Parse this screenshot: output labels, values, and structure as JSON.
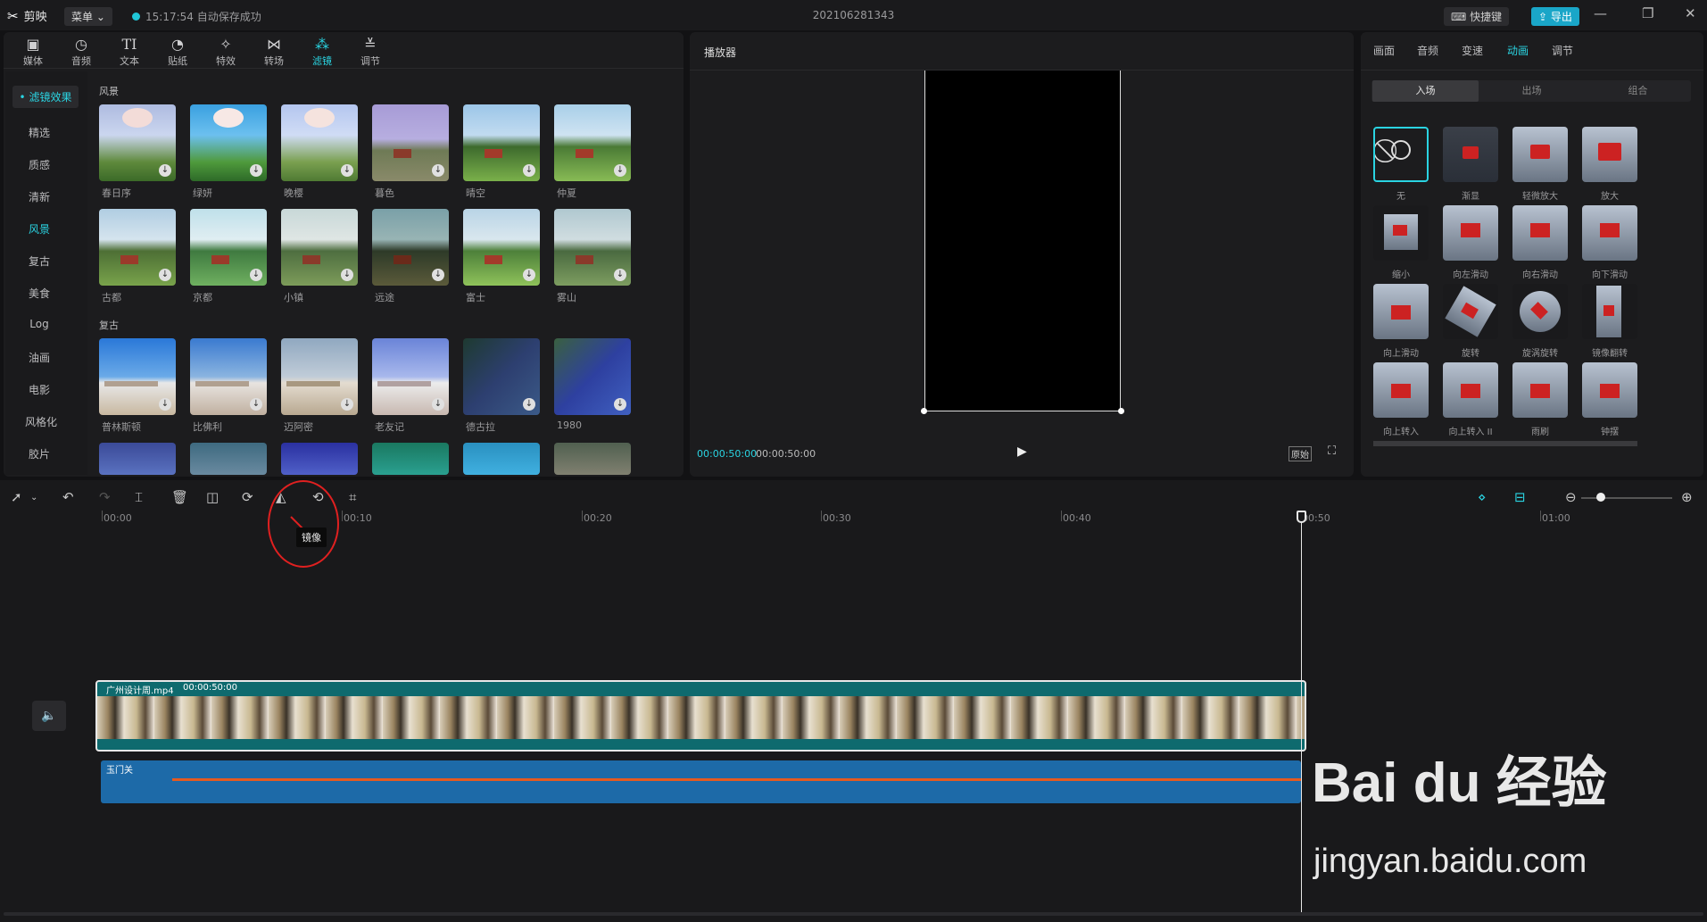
{
  "titlebar": {
    "app_name": "剪映",
    "menu_label": "菜单",
    "save_status": "15:17:54 自动保存成功",
    "project_name": "202106281343",
    "shortcut_label": "快捷键",
    "export_label": "导出"
  },
  "toolbar": {
    "items": [
      {
        "label": "媒体",
        "icon": "media-icon"
      },
      {
        "label": "音频",
        "icon": "audio-icon"
      },
      {
        "label": "文本",
        "icon": "text-icon"
      },
      {
        "label": "贴纸",
        "icon": "sticker-icon"
      },
      {
        "label": "特效",
        "icon": "effects-icon"
      },
      {
        "label": "转场",
        "icon": "transition-icon"
      },
      {
        "label": "滤镜",
        "icon": "filter-icon"
      },
      {
        "label": "调节",
        "icon": "adjust-icon"
      }
    ],
    "active_index": 6
  },
  "sidebar": {
    "selected": "滤镜效果",
    "items": [
      "精选",
      "质感",
      "清新",
      "风景",
      "复古",
      "美食",
      "Log",
      "油画",
      "电影",
      "风格化",
      "胶片"
    ],
    "active_item": "风景"
  },
  "filters": {
    "section_scenery": "风景",
    "section_retro": "复古",
    "row1": [
      "春日序",
      "绿妍",
      "晚樱",
      "暮色",
      "晴空",
      "仲夏"
    ],
    "row2": [
      "古都",
      "京都",
      "小镇",
      "远途",
      "富士",
      "雾山"
    ],
    "row3": [
      "普林斯顿",
      "比佛利",
      "迈阿密",
      "老友记",
      "德古拉",
      "1980"
    ]
  },
  "player": {
    "title": "播放器",
    "current_time": "00:00:50:00",
    "total_time": "00:00:50:00",
    "ratio_label": "原始"
  },
  "right_panel": {
    "tabs": [
      "画面",
      "音频",
      "变速",
      "动画",
      "调节"
    ],
    "active_tab": "动画",
    "segments": [
      "入场",
      "出场",
      "组合"
    ],
    "active_segment": "入场",
    "animations": [
      "无",
      "渐显",
      "轻微放大",
      "放大",
      "缩小",
      "向左滑动",
      "向右滑动",
      "向下滑动",
      "向上滑动",
      "旋转",
      "旋涡旋转",
      "镜像翻转",
      "向上转入",
      "向上转入 II",
      "雨刷",
      "钟摆"
    ]
  },
  "timeline": {
    "tooltip": "镜像",
    "ruler_labels": [
      "00:00",
      "00:10",
      "00:20",
      "00:30",
      "00:40",
      "00:50",
      "01:00"
    ],
    "video_clip_name": "广州设计周.mp4",
    "video_clip_duration": "00:00:50:00",
    "audio_clip_name": "玉门关"
  },
  "watermark": {
    "brand": "Bai du 经验",
    "url": "jingyan.baidu.com"
  }
}
